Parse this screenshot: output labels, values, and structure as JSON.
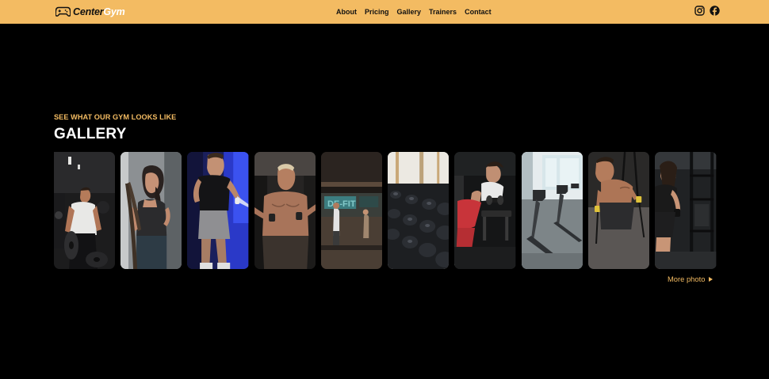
{
  "header": {
    "logo": {
      "part1": "Center",
      "part2": "Gym",
      "icon": "gamepad-icon"
    },
    "nav": [
      {
        "label": "About"
      },
      {
        "label": "Pricing"
      },
      {
        "label": "Gallery"
      },
      {
        "label": "Trainers"
      },
      {
        "label": "Contact"
      }
    ],
    "social": [
      {
        "icon": "instagram-icon"
      },
      {
        "icon": "facebook-icon"
      }
    ]
  },
  "gallery": {
    "kicker": "SEE WHAT OUR GYM LOOKS LIKE",
    "title": "GALLERY",
    "more_label": "More photo",
    "photos": [
      {
        "subject": "man carrying weight plates"
      },
      {
        "subject": "woman with battle ropes"
      },
      {
        "subject": "man with resistance bands"
      },
      {
        "subject": "man doing cable fly"
      },
      {
        "subject": "gym floor"
      },
      {
        "subject": "dumbbell rack"
      },
      {
        "subject": "woman on bench with dumbbell"
      },
      {
        "subject": "treadmills"
      },
      {
        "subject": "man on suspension trainer"
      },
      {
        "subject": "woman in cable station"
      }
    ]
  },
  "colors": {
    "accent": "#f3bb62",
    "background": "#000000",
    "text": "#ffffff"
  }
}
